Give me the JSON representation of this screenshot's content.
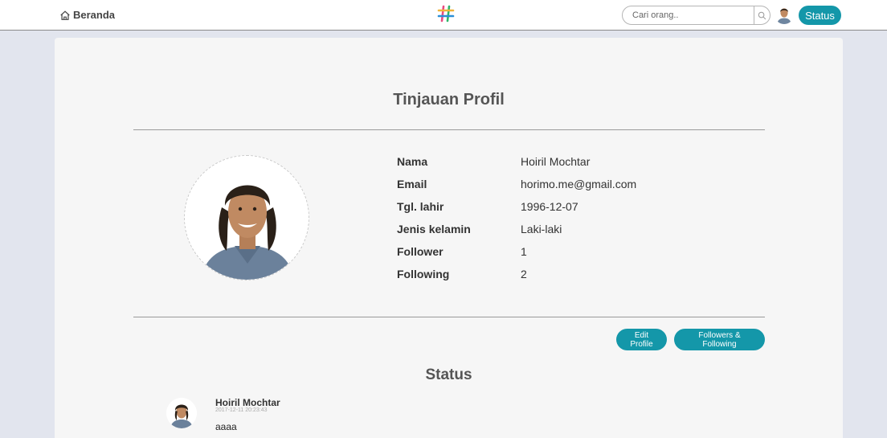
{
  "navbar": {
    "home_label": "Beranda",
    "logo_glyph": "#",
    "search_placeholder": "Cari orang..",
    "status_button": "Status"
  },
  "profile": {
    "title": "Tinjauan Profil",
    "fields": [
      {
        "label": "Nama",
        "value": "Hoiril Mochtar"
      },
      {
        "label": "Email",
        "value": "horimo.me@gmail.com"
      },
      {
        "label": "Tgl. lahir",
        "value": "1996-12-07"
      },
      {
        "label": "Jenis kelamin",
        "value": "Laki-laki"
      },
      {
        "label": "Follower",
        "value": "1"
      },
      {
        "label": "Following",
        "value": "2"
      }
    ],
    "edit_button": "Edit Profile",
    "followers_button": "Followers & Following"
  },
  "status": {
    "title": "Status",
    "posts": [
      {
        "author": "Hoiril Mochtar",
        "time": "2017-12-11 20:23:43",
        "text": "aaaa"
      }
    ]
  },
  "colors": {
    "accent": "#1497a9",
    "page_bg": "#e2e5ee",
    "card_bg": "#f6f6f6"
  }
}
